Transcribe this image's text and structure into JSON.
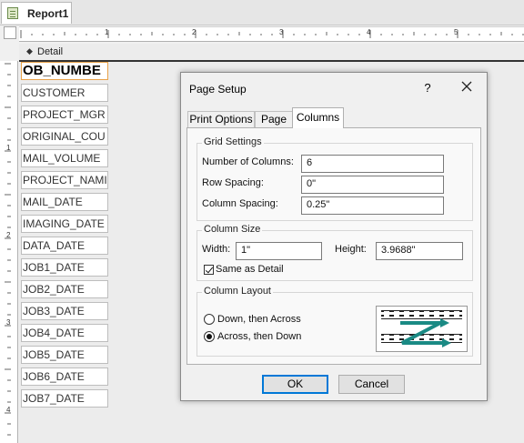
{
  "document_tab": {
    "label": "Report1"
  },
  "ruler": {
    "h_marks": [
      "1",
      "2",
      "3",
      "4",
      "5"
    ],
    "v_marks": [
      "1",
      "2",
      "3",
      "4"
    ]
  },
  "section": {
    "arrow": "◆",
    "name": "Detail"
  },
  "fields": [
    "OB_NUMBE",
    "CUSTOMER",
    "PROJECT_MGR",
    "ORIGINAL_COU",
    "MAIL_VOLUME",
    "PROJECT_NAMI",
    "MAIL_DATE",
    "IMAGING_DATE",
    "DATA_DATE",
    "JOB1_DATE",
    "JOB2_DATE",
    "JOB3_DATE",
    "JOB4_DATE",
    "JOB5_DATE",
    "JOB6_DATE",
    "JOB7_DATE"
  ],
  "dialog": {
    "title": "Page Setup",
    "help": "?",
    "tabs": [
      "Print Options",
      "Page",
      "Columns"
    ],
    "active_tab": "Columns",
    "grid": {
      "legend": "Grid Settings",
      "num_columns_label": "Number of Columns:",
      "num_columns_value": "6",
      "row_spacing_label": "Row Spacing:",
      "row_spacing_value": "0\"",
      "column_spacing_label": "Column Spacing:",
      "column_spacing_value": "0.25\""
    },
    "size": {
      "legend": "Column Size",
      "width_label": "Width:",
      "width_value": "1\"",
      "height_label": "Height:",
      "height_value": "3.9688\"",
      "same_as_detail_label": "Same as Detail",
      "same_as_detail_checked": true
    },
    "layout": {
      "legend": "Column Layout",
      "option_down": "Down, then Across",
      "option_across": "Across, then Down",
      "selected": "across"
    },
    "ok_label": "OK",
    "cancel_label": "Cancel"
  },
  "colors": {
    "accent": "#0078d7",
    "selection": "#e8a24a",
    "layout_arrow": "#1a8a84"
  }
}
